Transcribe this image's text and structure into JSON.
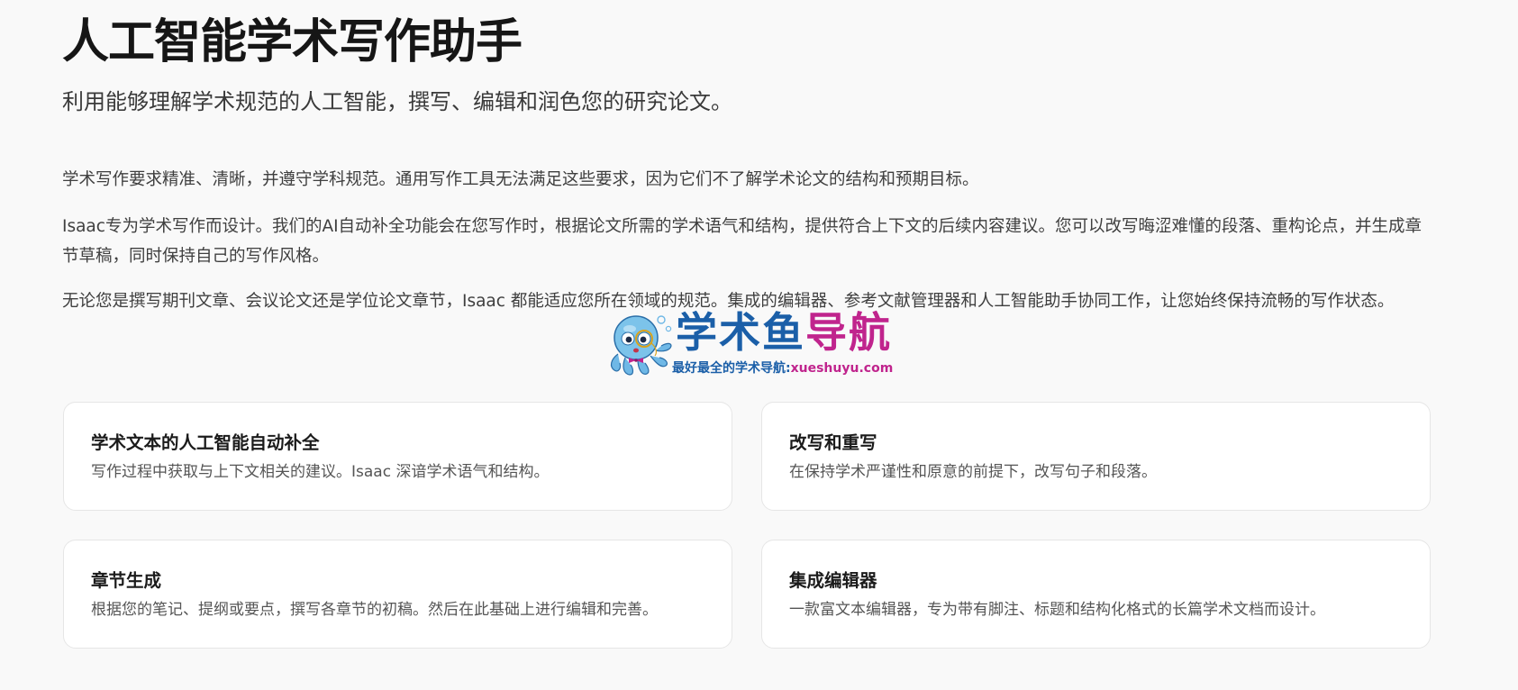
{
  "header": {
    "title": "人工智能学术写作助手",
    "subtitle": "利用能够理解学术规范的人工智能，撰写、编辑和润色您的研究论文。"
  },
  "intro": {
    "paragraphs": [
      "学术写作要求精准、清晰，并遵守学科规范。通用写作工具无法满足这些要求，因为它们不了解学术论文的结构和预期目标。",
      "Isaac专为学术写作而设计。我们的AI自动补全功能会在您写作时，根据论文所需的学术语气和结构，提供符合上下文的后续内容建议。您可以改写晦涩难懂的段落、重构论点，并生成章节草稿，同时保持自己的写作风格。",
      "无论您是撰写期刊文章、会议论文还是学位论文章节，Isaac 都能适应您所在领域的规范。集成的编辑器、参考文献管理器和人工智能助手协同工作，让您始终保持流畅的写作状态。"
    ]
  },
  "features": [
    {
      "title": "学术文本的人工智能自动补全",
      "description": "写作过程中获取与上下文相关的建议。Isaac 深谙学术语气和结构。"
    },
    {
      "title": "改写和重写",
      "description": "在保持学术严谨性和原意的前提下，改写句子和段落。"
    },
    {
      "title": "章节生成",
      "description": "根据您的笔记、提纲或要点，撰写各章节的初稿。然后在此基础上进行编辑和完善。"
    },
    {
      "title": "集成编辑器",
      "description": "一款富文本编辑器，专为带有脚注、标题和结构化格式的长篇学术文档而设计。"
    }
  ],
  "watermark": {
    "main_a": "学术鱼",
    "main_b": "导航",
    "sub_a": "最好最全的学术导航:",
    "sub_b": "xueshuyu.com",
    "icon": "octopus-mascot-icon",
    "colors": {
      "blue": "#1b5fa8",
      "magenta": "#c0248d"
    }
  },
  "colors": {
    "background": "#f9f9f9",
    "card": "#ffffff",
    "card_border": "#e6e6e6"
  }
}
